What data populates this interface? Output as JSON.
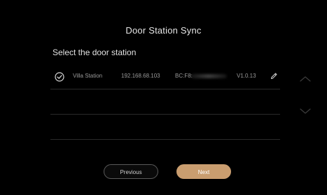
{
  "header": {
    "title": "Door Station Sync",
    "subtitle": "Select the door station"
  },
  "stations": [
    {
      "name": "Villa Station",
      "ip": "192.168.68.103",
      "mac_prefix": "BC:F8:",
      "version": "V1.0.13",
      "selected": true
    }
  ],
  "footer": {
    "previous_label": "Previous",
    "next_label": "Next"
  },
  "colors": {
    "accent": "#c99d6f",
    "background": "#000000",
    "text_primary": "#e6e6e6",
    "text_secondary": "#9a9a9a"
  },
  "icons": {
    "selected": "check-circle-icon",
    "edit": "pencil-icon",
    "scroll_up": "chevron-up-icon",
    "scroll_down": "chevron-down-icon"
  }
}
